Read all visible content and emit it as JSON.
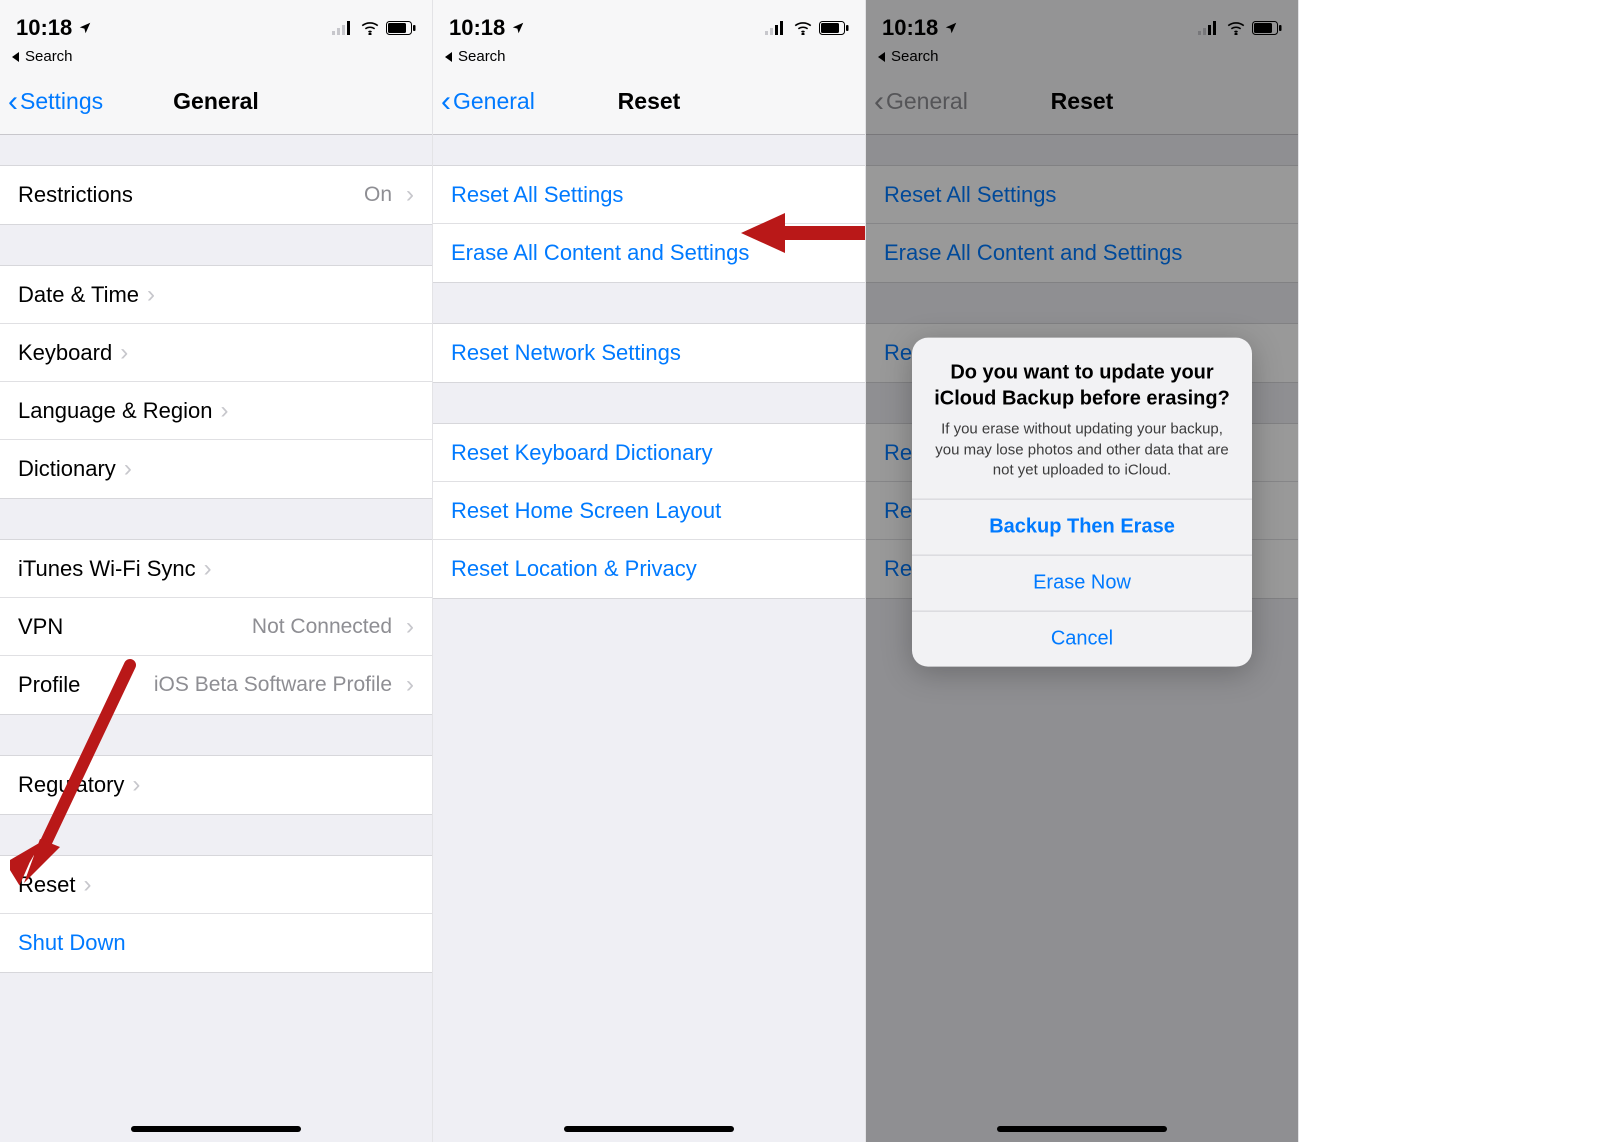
{
  "statusbar": {
    "time": "10:18",
    "back_crumb": "Search"
  },
  "screen1": {
    "nav": {
      "back": "Settings",
      "title": "General"
    },
    "groups": [
      {
        "cells": [
          {
            "label": "Restrictions",
            "value": "On",
            "disclosure": true
          }
        ]
      },
      {
        "cells": [
          {
            "label": "Date & Time",
            "disclosure": true
          },
          {
            "label": "Keyboard",
            "disclosure": true
          },
          {
            "label": "Language & Region",
            "disclosure": true
          },
          {
            "label": "Dictionary",
            "disclosure": true
          }
        ]
      },
      {
        "cells": [
          {
            "label": "iTunes Wi-Fi Sync",
            "disclosure": true
          },
          {
            "label": "VPN",
            "value": "Not Connected",
            "disclosure": true
          },
          {
            "label": "Profile",
            "value": "iOS Beta Software Profile",
            "disclosure": true
          }
        ]
      },
      {
        "cells": [
          {
            "label": "Regulatory",
            "disclosure": true
          }
        ]
      },
      {
        "cells": [
          {
            "label": "Reset",
            "disclosure": true
          },
          {
            "label": "Shut Down",
            "link": true
          }
        ]
      }
    ]
  },
  "screen2": {
    "nav": {
      "back": "General",
      "title": "Reset"
    },
    "groups": [
      {
        "cells": [
          {
            "label": "Reset All Settings",
            "link": true
          },
          {
            "label": "Erase All Content and Settings",
            "link": true,
            "highlight_arrow": true
          }
        ]
      },
      {
        "cells": [
          {
            "label": "Reset Network Settings",
            "link": true
          }
        ]
      },
      {
        "cells": [
          {
            "label": "Reset Keyboard Dictionary",
            "link": true
          },
          {
            "label": "Reset Home Screen Layout",
            "link": true
          },
          {
            "label": "Reset Location & Privacy",
            "link": true
          }
        ]
      }
    ]
  },
  "screen3": {
    "nav": {
      "back": "General",
      "title": "Reset"
    },
    "groups": [
      {
        "cells": [
          {
            "label": "Reset All Settings",
            "link": true
          },
          {
            "label": "Erase All Content and Settings",
            "link": true
          }
        ]
      },
      {
        "cells": [
          {
            "label": "Rese",
            "link": true
          }
        ]
      },
      {
        "cells": [
          {
            "label": "Rese",
            "link": true
          },
          {
            "label": "Rese",
            "link": true
          },
          {
            "label": "Rese",
            "link": true
          }
        ]
      }
    ],
    "alert": {
      "title": "Do you want to update your iCloud Backup before erasing?",
      "message": "If you erase without updating your backup, you may lose photos and other data that are not yet uploaded to iCloud.",
      "actions": [
        {
          "label": "Backup Then Erase",
          "bold": true
        },
        {
          "label": "Erase Now"
        },
        {
          "label": "Cancel"
        }
      ]
    }
  }
}
